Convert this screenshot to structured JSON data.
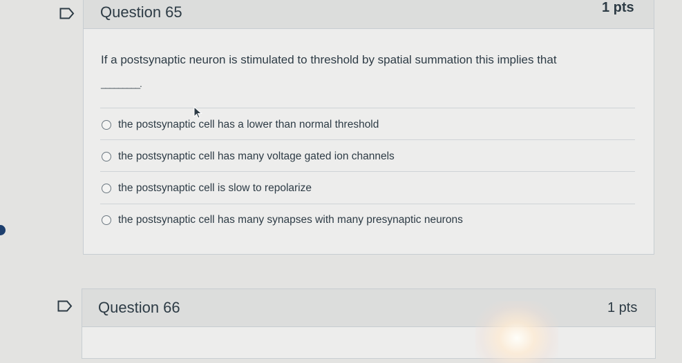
{
  "questions": [
    {
      "title": "Question 65",
      "points": "1 pts",
      "prompt": "If a postsynaptic neuron is stimulated to threshold by spatial summation this implies that",
      "blank": "_________.",
      "answers": [
        "the postsynaptic cell has a lower than normal threshold",
        "the postsynaptic cell has many voltage gated ion channels",
        "the postsynaptic cell is slow to repolarize",
        "the postsynaptic cell has many synapses with many presynaptic neurons"
      ]
    },
    {
      "title": "Question 66",
      "points": "1 pts"
    }
  ],
  "icons": {
    "flag": "flag-icon",
    "radio": "radio-button-icon",
    "cursor": "mouse-pointer-icon"
  },
  "colors": {
    "text": "#2d3b45",
    "header_bg": "#dcdddc",
    "body_bg": "#ededec",
    "border": "#c7cdd1"
  }
}
